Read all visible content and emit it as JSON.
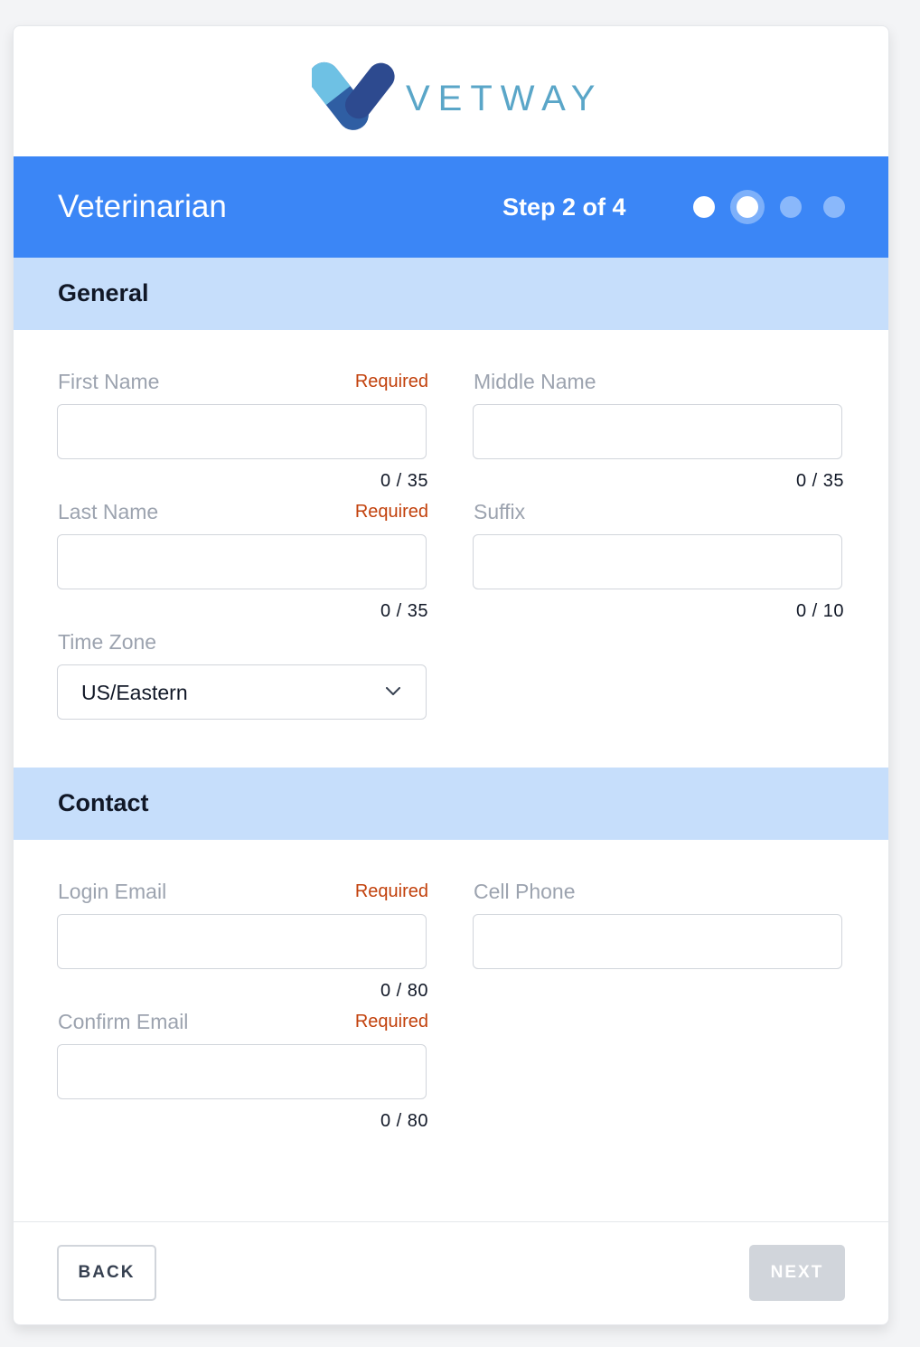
{
  "brand": {
    "name": "VETWAY",
    "colors": {
      "light": "#6ec1e4",
      "dark": "#2d4a8f",
      "text": "#5aa6c8"
    }
  },
  "header": {
    "title": "Veterinarian",
    "step": "Step 2 of 4",
    "step_current": 2,
    "step_total": 4,
    "accent": "#3b86f6"
  },
  "sections": {
    "general": "General",
    "contact": "Contact"
  },
  "fields": {
    "first_name": {
      "label": "First Name",
      "required": "Required",
      "value": "",
      "counter": "0 / 35"
    },
    "middle_name": {
      "label": "Middle Name",
      "value": "",
      "counter": "0 / 35"
    },
    "last_name": {
      "label": "Last Name",
      "required": "Required",
      "value": "",
      "counter": "0 / 35"
    },
    "suffix": {
      "label": "Suffix",
      "value": "",
      "counter": "0 / 10"
    },
    "time_zone": {
      "label": "Time Zone",
      "selected": "US/Eastern"
    },
    "login_email": {
      "label": "Login Email",
      "required": "Required",
      "value": "",
      "counter": "0 / 80"
    },
    "cell_phone": {
      "label": "Cell Phone",
      "value": ""
    },
    "confirm_email": {
      "label": "Confirm Email",
      "required": "Required",
      "value": "",
      "counter": "0 / 80"
    }
  },
  "footer": {
    "back_label": "BACK",
    "next_label": "NEXT"
  },
  "icons": {
    "logo": "vetway-pill-logo-icon",
    "select": "chevron-down-icon"
  }
}
